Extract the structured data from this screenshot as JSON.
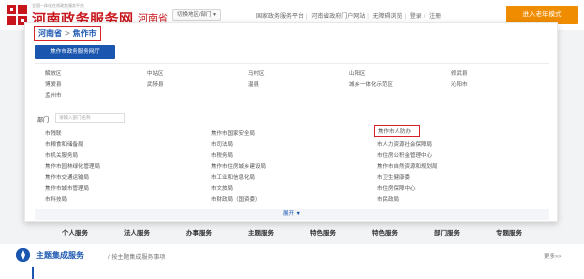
{
  "header": {
    "logo_subtitle": "全国一体化在线政务服务平台",
    "logo_title": "河南政务服务网",
    "province": "河南省",
    "switch_label": "切换地区/部门",
    "links": [
      "国家政务服务平台",
      "河南省政府门户网站",
      "无障碍浏览",
      "登录",
      "注册"
    ],
    "elder_mode": "进入老年模式"
  },
  "panel": {
    "breadcrumb": {
      "province": "河南省",
      "separator": ">",
      "city": "焦作市"
    },
    "platform_button": "焦作市政务服务网厅",
    "districts": [
      [
        "解放区",
        "中站区",
        "马村区",
        "山阳区",
        "修武县"
      ],
      [
        "博爱县",
        "武陟县",
        "温县",
        "城乡一体化示范区",
        "沁阳市"
      ],
      [
        "孟州市"
      ]
    ],
    "dept_label": "部门",
    "dept_search_placeholder": "请输入部门名称",
    "departments": [
      [
        "市残联",
        "焦作市国家安全局",
        "焦作市人防办"
      ],
      [
        "市粮食和储备局",
        "市司法局",
        "市人力资源社会保障局"
      ],
      [
        "市机关服务局",
        "市税务局",
        "市住房公积金管理中心"
      ],
      [
        "焦作市园林绿化管理局",
        "焦作市住房城乡建设局",
        "焦作市自然资源和规划局"
      ],
      [
        "焦作市交通运输局",
        "市工业和信息化局",
        "市卫生健康委"
      ],
      [
        "焦作市城市管理局",
        "市文旅局",
        "市住房保障中心"
      ],
      [
        "市科技局",
        "市财政局（国资委）",
        "市民政局"
      ]
    ],
    "expand": "展开"
  },
  "services": [
    "个人服务",
    "法人服务",
    "办事服务",
    "主题服务",
    "特色服务",
    "特色服务",
    "部门服务",
    "专题服务"
  ],
  "themes": {
    "title": "主题集成服务",
    "subtitle": "/ 按主题集成服务事项",
    "more": "更多>>"
  },
  "colors": {
    "brand_red": "#c8161d",
    "brand_blue": "#1a56b0",
    "elder_orange": "#f08c00",
    "highlight_red": "#d4232a"
  }
}
